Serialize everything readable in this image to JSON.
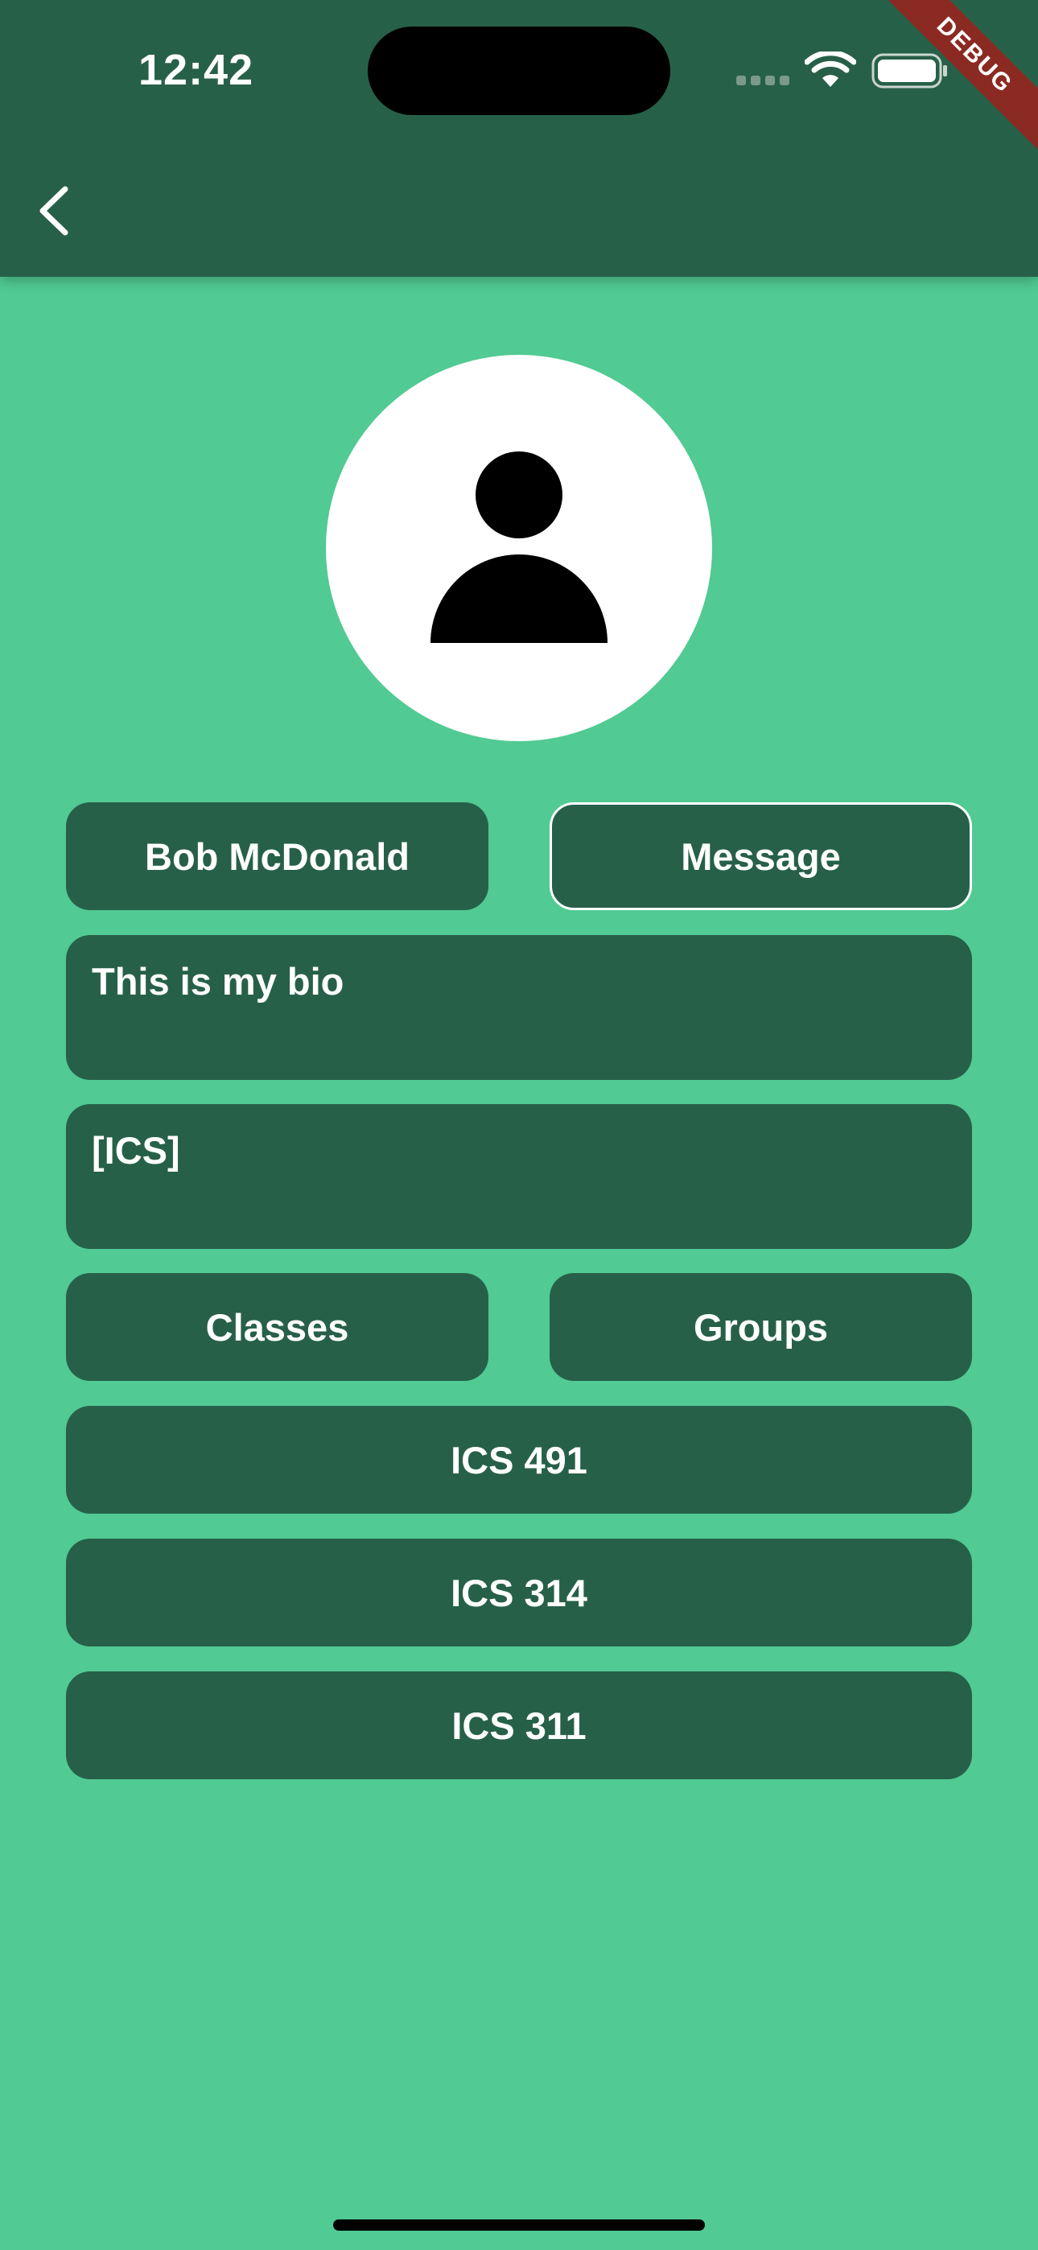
{
  "status_bar": {
    "time": "12:42",
    "wifi_icon": "wifi-icon",
    "battery_icon": "battery-full-icon"
  },
  "debug_banner": "DEBUG",
  "app_bar": {
    "back_icon": "chevron-left-icon"
  },
  "profile": {
    "avatar_icon": "person-icon",
    "name": "Bob McDonald",
    "message_label": "Message",
    "bio": "This is my bio",
    "tags": "[ICS]"
  },
  "toggles": {
    "classes_label": "Classes",
    "groups_label": "Groups"
  },
  "class_list": [
    {
      "label": "ICS 491"
    },
    {
      "label": "ICS 314"
    },
    {
      "label": "ICS 311"
    }
  ],
  "colors": {
    "background": "#51ca93",
    "primary_dark": "#276049",
    "text": "#ffffff",
    "debug_ribbon": "#8b2a22"
  }
}
